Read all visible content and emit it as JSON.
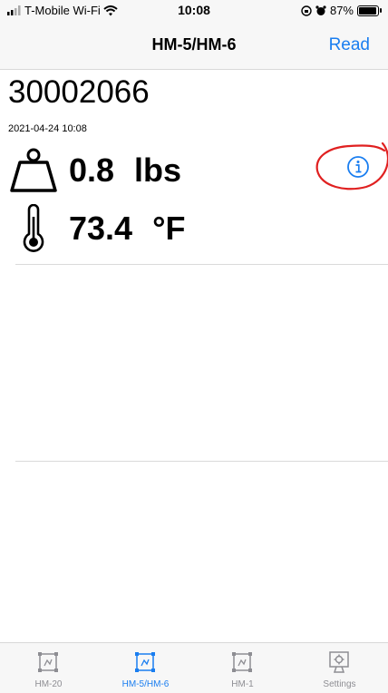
{
  "status_bar": {
    "carrier": "T-Mobile Wi-Fi",
    "time": "10:08",
    "battery": "87%",
    "battery_level": 0.87
  },
  "nav": {
    "title": "HM-5/HM-6",
    "action_label": "Read"
  },
  "reading": {
    "device_id": "30002066",
    "timestamp": "2021-04-24 10:08",
    "weight_value": "0.8",
    "weight_unit": "lbs",
    "temperature_value": "73.4",
    "temperature_unit": "°F"
  },
  "annotation": {
    "color": "#e02020"
  },
  "colors": {
    "accent": "#1a7ef0",
    "inactive": "#8e8e93"
  },
  "tabs": [
    {
      "label": "HM-20",
      "icon": "device-grid-icon",
      "active": false
    },
    {
      "label": "HM-5/HM-6",
      "icon": "device-grid-icon",
      "active": true
    },
    {
      "label": "HM-1",
      "icon": "device-grid-icon",
      "active": false
    },
    {
      "label": "Settings",
      "icon": "gear-icon",
      "active": false
    }
  ]
}
